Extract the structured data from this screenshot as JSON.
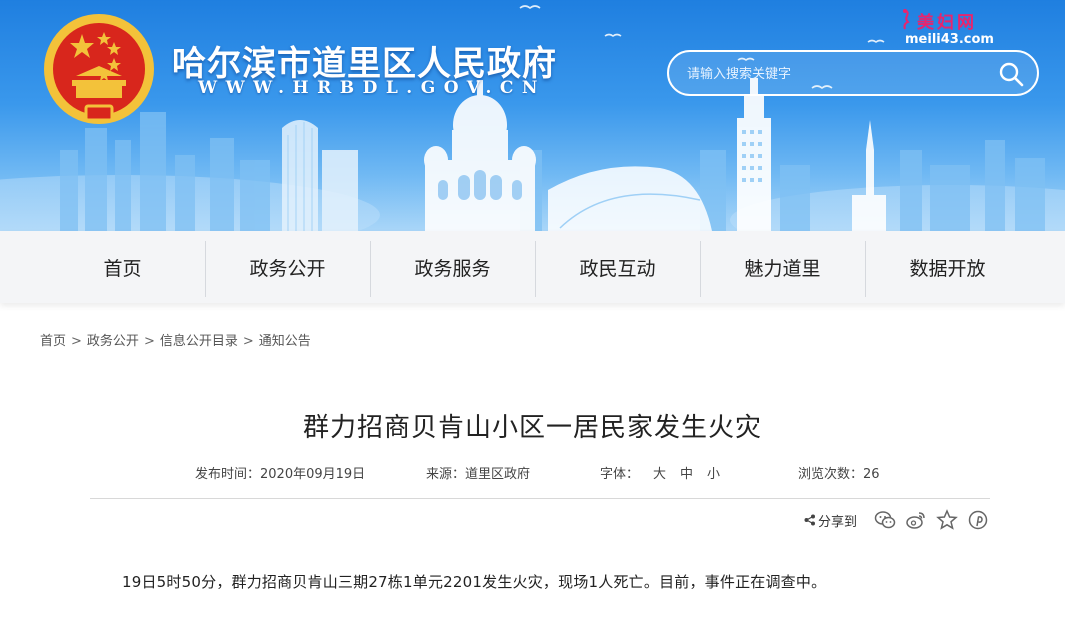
{
  "header": {
    "site_name": "哈尔滨市道里区人民政府",
    "site_url": "WWW.HRBDL.GOV.CN",
    "search": {
      "placeholder": "请输入搜索关键字"
    },
    "watermark": {
      "title": "美妇网",
      "url": "meili43.com"
    }
  },
  "nav": {
    "items": [
      {
        "label": "首页"
      },
      {
        "label": "政务公开"
      },
      {
        "label": "政务服务"
      },
      {
        "label": "政民互动"
      },
      {
        "label": "魅力道里"
      },
      {
        "label": "数据开放"
      }
    ]
  },
  "breadcrumb": {
    "items": [
      "首页",
      "政务公开",
      "信息公开目录",
      "通知公告"
    ],
    "separator": ">"
  },
  "article": {
    "title": "群力招商贝肯山小区一居民家发生火灾",
    "meta": {
      "date_label": "发布时间：",
      "date": "2020年09月19日",
      "source_label": "来源：",
      "source": "道里区政府",
      "font_label": "字体：",
      "font_large": "大",
      "font_medium": "中",
      "font_small": "小",
      "views_label": "浏览次数：",
      "views": "26"
    },
    "share_label": "分享到",
    "body": "19日5时50分，群力招商贝肯山三期27栋1单元2201发生火灾，现场1人死亡。目前，事件正在调查中。"
  },
  "colors": {
    "banner_top": "#1f7fe0",
    "banner_bottom": "#a9d6f8",
    "nav_bg": "#f4f5f7",
    "emblem_red": "#d8261c",
    "emblem_gold": "#f3c23a",
    "watermark_pink": "#e8246e"
  },
  "icons": [
    "national-emblem-icon",
    "search-icon",
    "share-icon",
    "wechat-icon",
    "weibo-icon",
    "star-icon",
    "pinterest-icon"
  ]
}
